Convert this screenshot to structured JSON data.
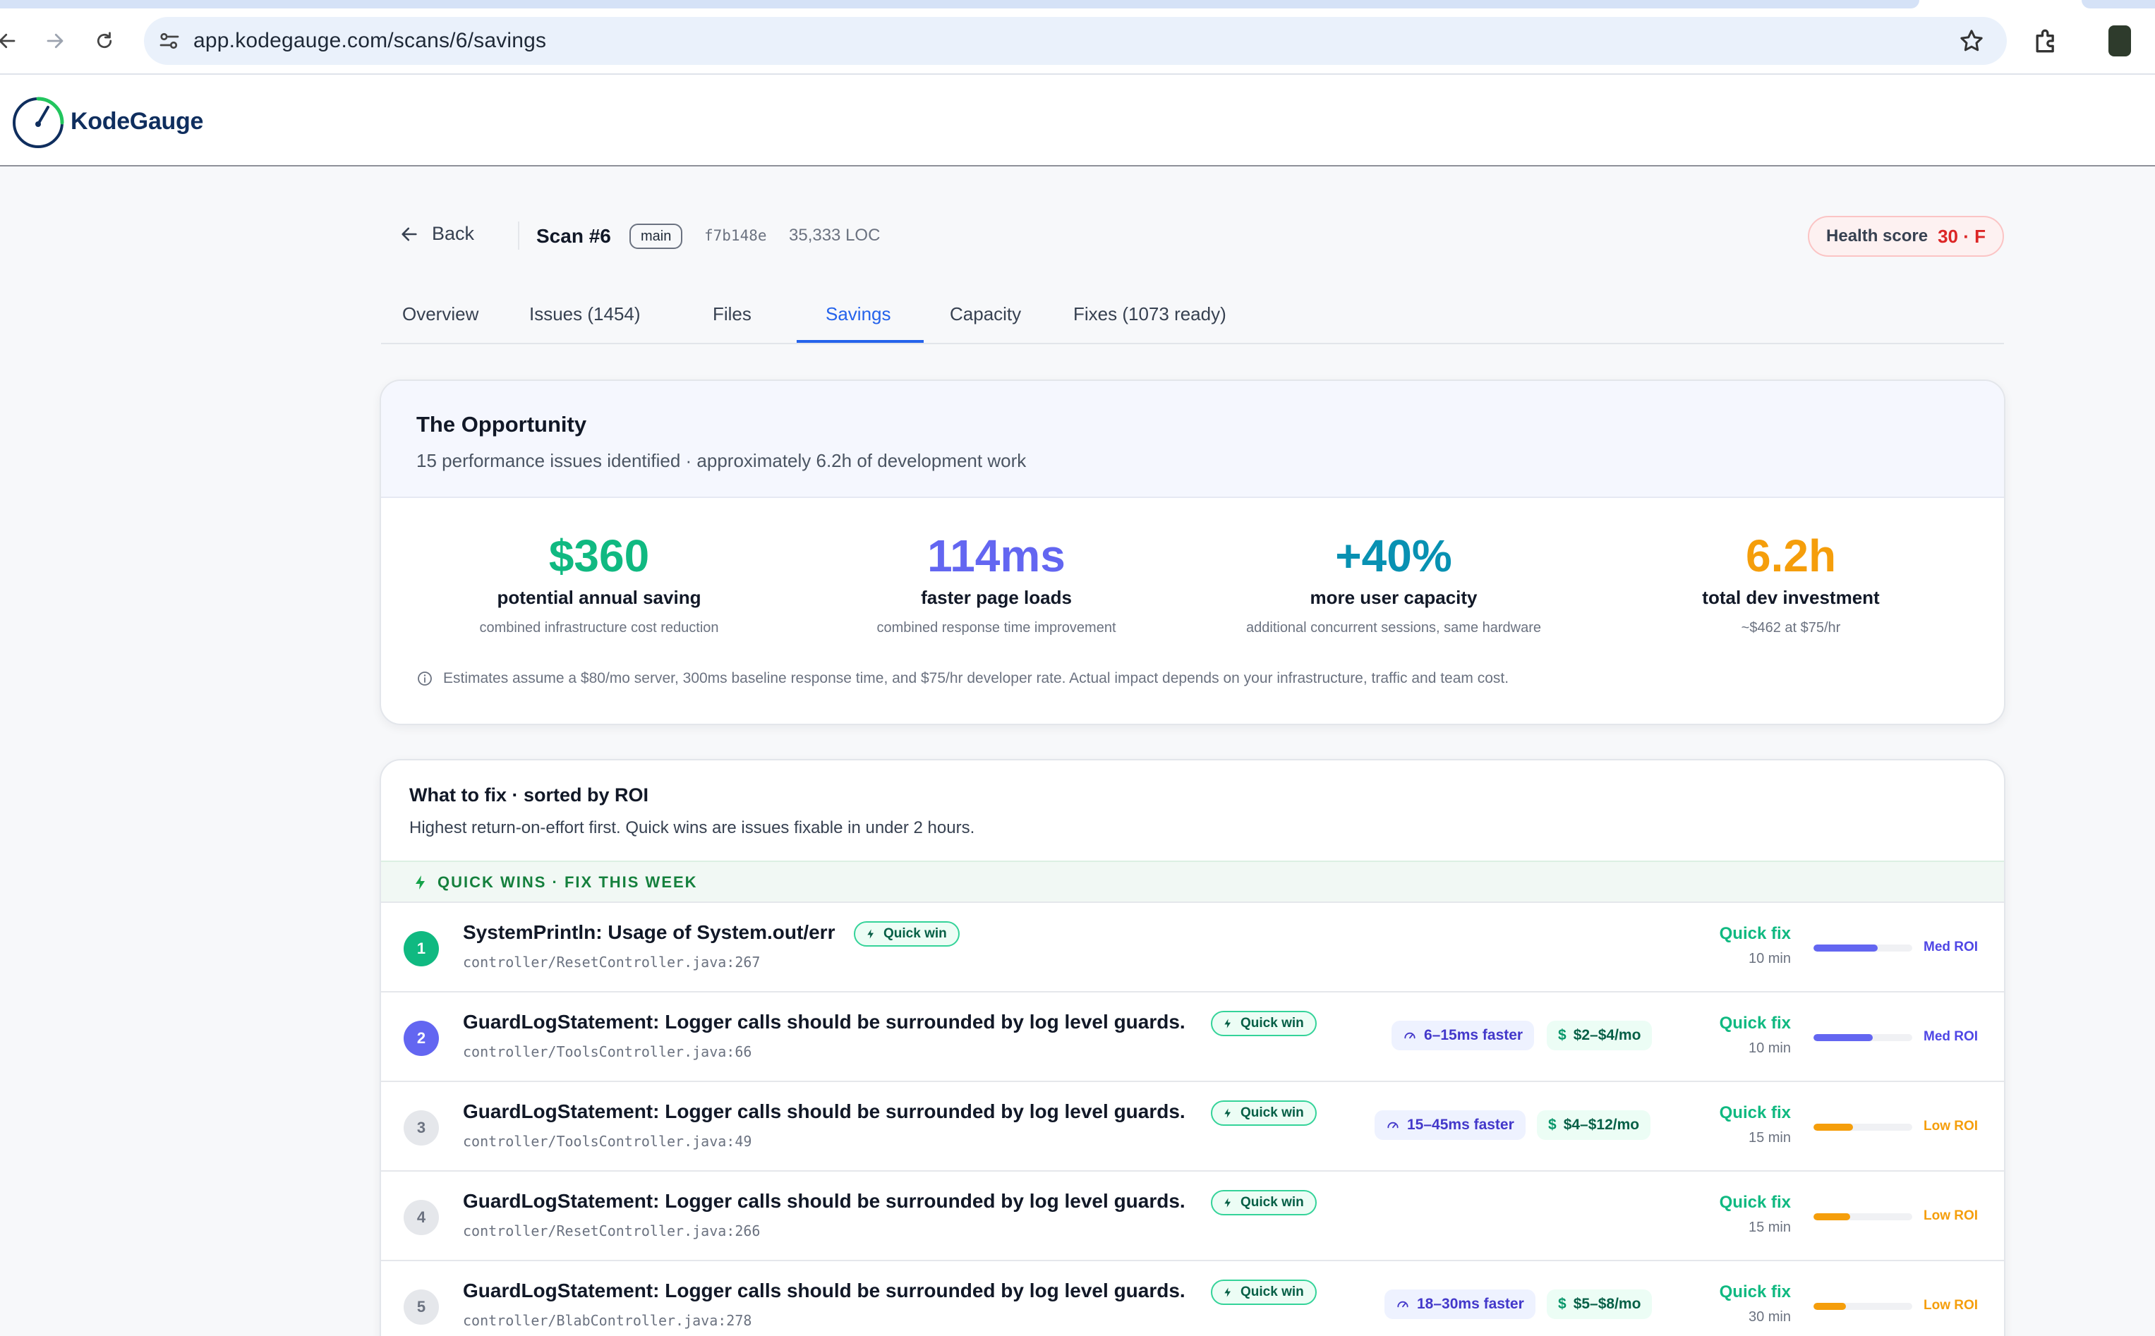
{
  "browser": {
    "url": "app.kodegauge.com/scans/6/savings"
  },
  "app": {
    "brand": "KodeGauge"
  },
  "scan": {
    "back_label": "Back",
    "title": "Scan #6",
    "branch": "main",
    "commit": "f7b148e",
    "loc": "35,333 LOC",
    "health_label": "Health score",
    "health_value": "30 · F"
  },
  "tabs": [
    {
      "label": "Overview"
    },
    {
      "label": "Issues (1454)"
    },
    {
      "label": "Files"
    },
    {
      "label": "Savings",
      "active": true
    },
    {
      "label": "Capacity"
    },
    {
      "label": "Fixes (1073 ready)"
    }
  ],
  "opportunity": {
    "title": "The Opportunity",
    "subtitle": "15 performance issues identified · approximately 6.2h of development work",
    "metrics": [
      {
        "value": "$360",
        "label": "potential annual saving",
        "caption": "combined infrastructure cost reduction",
        "color": "#10b981"
      },
      {
        "value": "114ms",
        "label": "faster page loads",
        "caption": "combined response time improvement",
        "color": "#6366f1"
      },
      {
        "value": "+40%",
        "label": "more user capacity",
        "caption": "additional concurrent sessions, same hardware",
        "color": "#0891b2"
      },
      {
        "value": "6.2h",
        "label": "total dev investment",
        "caption": "~$462 at $75/hr",
        "color": "#f59e0b"
      }
    ],
    "note": "Estimates assume a $80/mo server, 300ms baseline response time, and $75/hr developer rate. Actual impact depends on your infrastructure, traffic and team cost."
  },
  "fixlist": {
    "title": "What to fix · sorted by ROI",
    "subtitle": "Highest return-on-effort first. Quick wins are issues fixable in under 2 hours.",
    "section_label": "QUICK WINS · FIX THIS WEEK",
    "badge_label": "Quick win",
    "rows": [
      {
        "rank": "1",
        "title": "SystemPrintln: Usage of System.out/err",
        "path": "controller/ResetController.java:267",
        "speed": "",
        "money": "",
        "effort": "Quick fix",
        "time": "10 min",
        "roi": "Med ROI",
        "roi_level": 0.65
      },
      {
        "rank": "2",
        "title": "GuardLogStatement: Logger calls should be surrounded by log level guards.",
        "path": "controller/ToolsController.java:66",
        "speed": "6–15ms faster",
        "money": "$2–$4/mo",
        "effort": "Quick fix",
        "time": "10 min",
        "roi": "Med ROI",
        "roi_level": 0.6
      },
      {
        "rank": "3",
        "title": "GuardLogStatement: Logger calls should be surrounded by log level guards.",
        "path": "controller/ToolsController.java:49",
        "speed": "15–45ms faster",
        "money": "$4–$12/mo",
        "effort": "Quick fix",
        "time": "15 min",
        "roi": "Low ROI",
        "roi_level": 0.4
      },
      {
        "rank": "4",
        "title": "GuardLogStatement: Logger calls should be surrounded by log level guards.",
        "path": "controller/ResetController.java:266",
        "speed": "",
        "money": "",
        "effort": "Quick fix",
        "time": "15 min",
        "roi": "Low ROI",
        "roi_level": 0.37
      },
      {
        "rank": "5",
        "title": "GuardLogStatement: Logger calls should be surrounded by log level guards.",
        "path": "controller/BlabController.java:278",
        "speed": "18–30ms faster",
        "money": "$5–$8/mo",
        "effort": "Quick fix",
        "time": "30 min",
        "roi": "Low ROI",
        "roi_level": 0.33
      }
    ]
  }
}
